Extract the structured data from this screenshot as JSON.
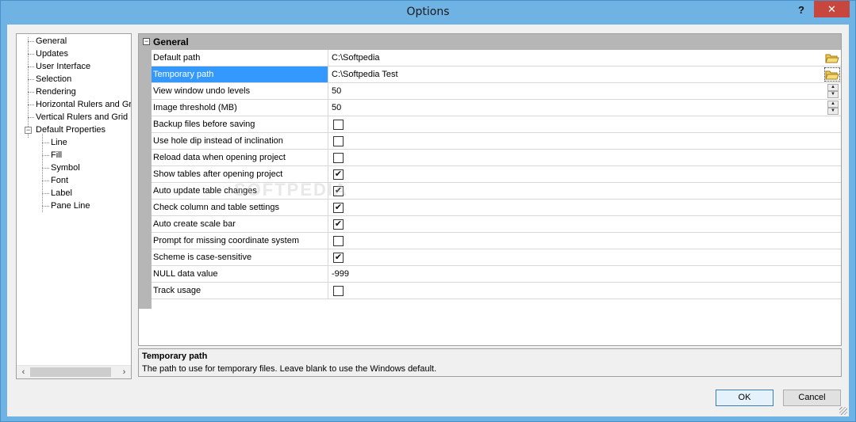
{
  "window": {
    "title": "Options",
    "help_label": "?",
    "close_label": "✕"
  },
  "tree": {
    "items": [
      {
        "label": "General"
      },
      {
        "label": "Updates"
      },
      {
        "label": "User Interface"
      },
      {
        "label": "Selection"
      },
      {
        "label": "Rendering"
      },
      {
        "label": "Horizontal Rulers and Gri"
      },
      {
        "label": "Vertical Rulers and Grid"
      },
      {
        "label": "Default Properties"
      },
      {
        "label": "Line"
      },
      {
        "label": "Fill"
      },
      {
        "label": "Symbol"
      },
      {
        "label": "Font"
      },
      {
        "label": "Label"
      },
      {
        "label": "Pane Line"
      }
    ],
    "expander_symbol": "−",
    "scroll_left": "‹",
    "scroll_right": "›"
  },
  "grid": {
    "category": "General",
    "category_toggle": "−",
    "rows": [
      {
        "name": "Default path",
        "value": "C:\\Softpedia"
      },
      {
        "name": "Temporary path",
        "value": "C:\\Softpedia Test"
      },
      {
        "name": "View window undo levels",
        "value": "50"
      },
      {
        "name": "Image threshold (MB)",
        "value": "50"
      },
      {
        "name": "Backup files before saving",
        "checked": false
      },
      {
        "name": "Use hole dip instead of inclination",
        "checked": false
      },
      {
        "name": "Reload data when opening project",
        "checked": false
      },
      {
        "name": "Show tables after opening project",
        "checked": true
      },
      {
        "name": "Auto update table changes",
        "checked": true
      },
      {
        "name": "Check column and table settings",
        "checked": true
      },
      {
        "name": "Auto create scale bar",
        "checked": true
      },
      {
        "name": "Prompt for missing coordinate system",
        "checked": false
      },
      {
        "name": "Scheme is case-sensitive",
        "checked": true
      },
      {
        "name": "NULL data value",
        "value": "-999"
      },
      {
        "name": "Track usage",
        "checked": false
      }
    ],
    "check_mark": "✔",
    "spin_up": "▲",
    "spin_down": "▼"
  },
  "description": {
    "title": "Temporary path",
    "text": "The path to use for temporary files.  Leave blank to use the Windows default."
  },
  "buttons": {
    "ok": "OK",
    "cancel": "Cancel"
  },
  "watermark": "SOFTPEDIA",
  "colors": {
    "selection": "#3399ff",
    "titlebar": "#6fb3e4",
    "close": "#c7463d"
  }
}
